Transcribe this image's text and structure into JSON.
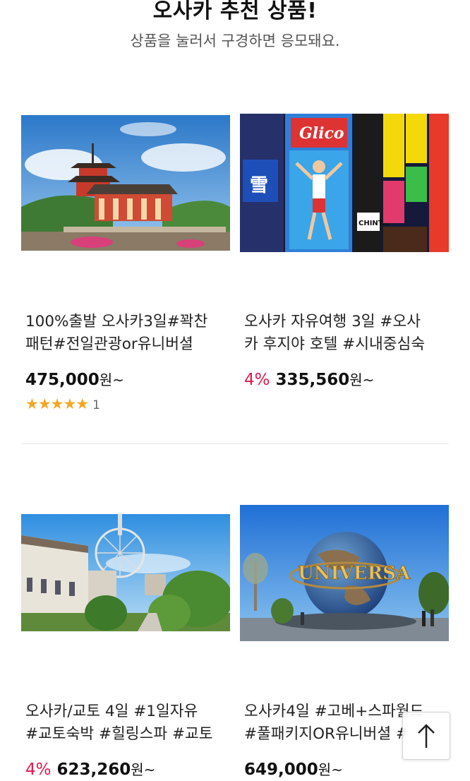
{
  "header": {
    "title": "오사카 추천 상품!",
    "subtitle": "상품을 눌러서 구경하면 응모돼요."
  },
  "products": [
    {
      "name_line1": "100%출발 오사카3일#꽉찬",
      "name_line2": "패턴#전일관광or유니버셜",
      "discount": "",
      "price": "475,000",
      "unit": "원~",
      "stars": "★★★★★",
      "review_count": "1",
      "image": "kiyomizu-temple"
    },
    {
      "name_line1": "오사카 자유여행 3일 #오사",
      "name_line2": "카 후지야 호텔 #시내중심숙",
      "discount": "4%",
      "price": "335,560",
      "unit": "원~",
      "image": "dotonbori-signs"
    },
    {
      "name_line1": "오사카/교토 4일 #1일자유",
      "name_line2": "#교토숙박 #힐링스파 #교토",
      "discount": "4%",
      "price": "623,260",
      "unit": "원~",
      "image": "outlet-ferris-wheel"
    },
    {
      "name_line1": "오사카4일 #고베+스파월드",
      "name_line2": "#풀패키지OR유니버셜 #",
      "discount": "",
      "price": "649,000",
      "unit": "원~",
      "image": "universal-globe",
      "globe_text": "UNIVERSA"
    }
  ],
  "scroll_top": {
    "icon": "arrow-up-icon"
  },
  "colors": {
    "discount": "#e5174d",
    "star": "#f5a623",
    "divider": "#e6e6e6"
  }
}
